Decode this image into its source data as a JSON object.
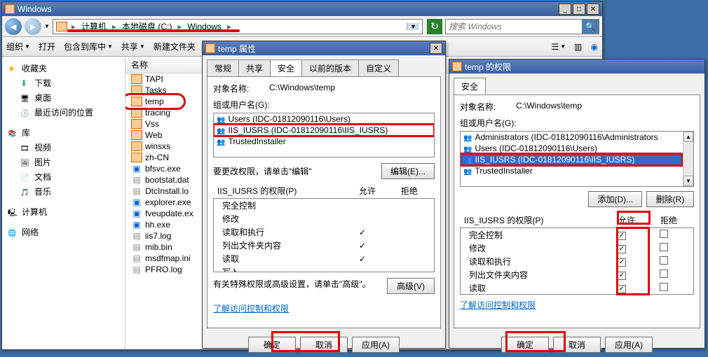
{
  "explorer": {
    "title": "Windows",
    "breadcrumb": [
      "计算机",
      "本地磁盘 (C:)",
      "Windows"
    ],
    "search_placeholder": "搜索 Windows",
    "toolbar": {
      "org": "组织",
      "open": "打开",
      "lib": "包含到库中",
      "share": "共享",
      "new": "新建文件夹"
    },
    "nav": {
      "fav": "收藏夹",
      "dl": "下载",
      "desk": "桌面",
      "recent": "最近访问的位置",
      "lib": "库",
      "vid": "视频",
      "pic": "图片",
      "doc": "文档",
      "mus": "音乐",
      "pc": "计算机",
      "net": "网络"
    },
    "col_name": "名称",
    "files": [
      {
        "n": "TAPI",
        "t": "folder"
      },
      {
        "n": "Tasks",
        "t": "folder"
      },
      {
        "n": "temp",
        "t": "folder",
        "hl": true
      },
      {
        "n": "tracing",
        "t": "folder"
      },
      {
        "n": "Vss",
        "t": "folder"
      },
      {
        "n": "Web",
        "t": "folder"
      },
      {
        "n": "winsxs",
        "t": "folder"
      },
      {
        "n": "zh-CN",
        "t": "folder"
      },
      {
        "n": "bfsvc.exe",
        "t": "exe"
      },
      {
        "n": "bootstat.dat",
        "t": "file"
      },
      {
        "n": "DtcInstall.lo",
        "t": "file"
      },
      {
        "n": "explorer.exe",
        "t": "exe"
      },
      {
        "n": "fveupdate.ex",
        "t": "exe"
      },
      {
        "n": "hh.exe",
        "t": "exe"
      },
      {
        "n": "iis7.log",
        "t": "file"
      },
      {
        "n": "mib.bin",
        "t": "file"
      },
      {
        "n": "msdfmap.ini",
        "t": "file"
      },
      {
        "n": "PFRO.log",
        "t": "file"
      }
    ]
  },
  "props": {
    "title": "temp 属性",
    "tabs": {
      "general": "常规",
      "share": "共享",
      "security": "安全",
      "prev": "以前的版本",
      "custom": "自定义"
    },
    "obj_label": "对象名称:",
    "obj_path": "C:\\Windows\\temp",
    "group_label": "组或用户名(G):",
    "users": [
      "Users (IDC-01812090116\\Users)",
      "IIS_IUSRS (IDC-01812090116\\IIS_IUSRS)",
      "TrustedInstaller"
    ],
    "edit_hint": "要更改权限，请单击\"编辑\"",
    "edit_btn": "编辑(E)...",
    "perm_header": "IIS_IUSRS 的权限(P)",
    "allow": "允许",
    "deny": "拒绝",
    "perms": [
      {
        "n": "完全控制",
        "a": false
      },
      {
        "n": "修改",
        "a": false
      },
      {
        "n": "读取和执行",
        "a": true
      },
      {
        "n": "列出文件夹内容",
        "a": true
      },
      {
        "n": "读取",
        "a": true
      },
      {
        "n": "写入",
        "a": false
      }
    ],
    "adv_hint": "有关特殊权限或高级设置，请单击\"高级\"。",
    "adv_btn": "高级(V)",
    "link": "了解访问控制和权限",
    "ok": "确定",
    "cancel": "取消",
    "apply": "应用(A)"
  },
  "perms": {
    "title": "temp 的权限",
    "tab_security": "安全",
    "obj_label": "对象名称:",
    "obj_path": "C:\\Windows\\temp",
    "group_label": "组或用户名(G):",
    "users": [
      {
        "n": "Administrators (IDC-01812090116\\Administrators",
        "sel": false
      },
      {
        "n": "Users (IDC-01812090116\\Users)",
        "sel": false
      },
      {
        "n": "IIS_IUSRS (IDC-01812090116\\IIS_IUSRS)",
        "sel": true
      },
      {
        "n": "TrustedInstaller",
        "sel": false
      }
    ],
    "add_btn": "添加(D)...",
    "remove_btn": "删除(R)",
    "perm_header": "IIS_IUSRS 的权限(P)",
    "allow": "允许",
    "deny": "拒绝",
    "perms": [
      {
        "n": "完全控制",
        "a": true,
        "d": false
      },
      {
        "n": "修改",
        "a": true,
        "d": false
      },
      {
        "n": "读取和执行",
        "a": true,
        "d": false
      },
      {
        "n": "列出文件夹内容",
        "a": true,
        "d": false
      },
      {
        "n": "读取",
        "a": true,
        "d": false
      }
    ],
    "link": "了解访问控制和权限",
    "ok": "确定",
    "cancel": "取消",
    "apply": "应用(A)"
  }
}
